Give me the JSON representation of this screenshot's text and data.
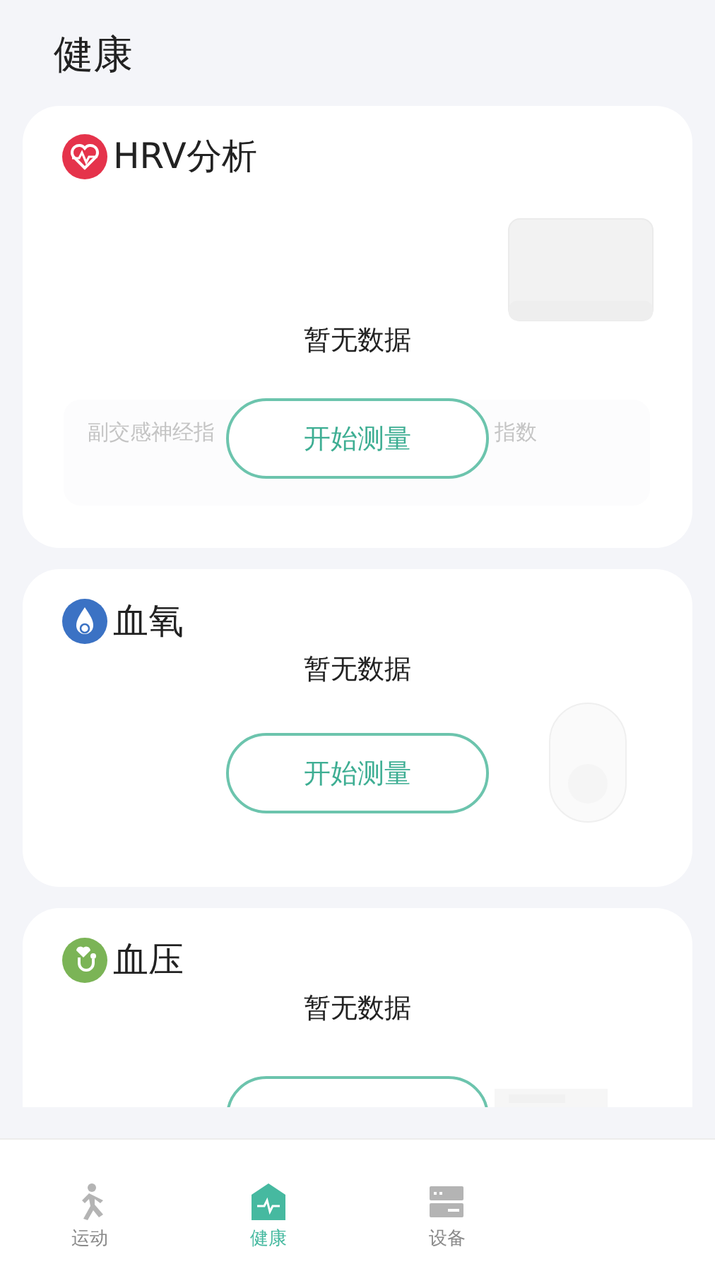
{
  "page_title": "健康",
  "cards": [
    {
      "kind": "hrv",
      "title": "HRV分析",
      "notice": "暂无数据",
      "button_label": "开始测量",
      "faded_texts": [
        "副交感神经指",
        "指数"
      ]
    },
    {
      "kind": "spo2",
      "title": "血氧",
      "notice": "暂无数据",
      "button_label": "开始测量"
    },
    {
      "kind": "bp",
      "title": "血压",
      "notice": "暂无数据"
    }
  ],
  "tab_bar": [
    {
      "kind": "run",
      "label": "运动",
      "selected": false
    },
    {
      "kind": "health",
      "label": "健康",
      "selected": true
    },
    {
      "kind": "device",
      "label": "设备",
      "selected": false
    }
  ]
}
